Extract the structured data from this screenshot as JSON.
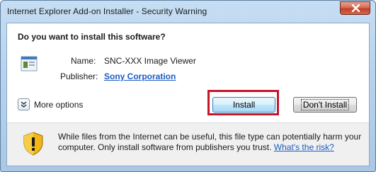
{
  "window": {
    "title": "Internet Explorer Add-on Installer - Security Warning"
  },
  "dialog": {
    "question": "Do you want to install this software?",
    "name_label": "Name:",
    "name_value": "SNC-XXX Image Viewer",
    "publisher_label": "Publisher:",
    "publisher_value": "Sony Corporation",
    "more_options": "More options",
    "install_label": "Install",
    "dont_install_label": "Don't Install",
    "warning_text": "While files from the Internet can be useful, this file type can potentially harm your computer. Only install software from publishers you trust.",
    "risk_link": "What's the risk?"
  },
  "colors": {
    "link": "#1c5bc3",
    "highlight_box": "#c5162c"
  },
  "icons": [
    "close-icon",
    "application-icon",
    "chevron-down-icon",
    "shield-warning-icon"
  ]
}
